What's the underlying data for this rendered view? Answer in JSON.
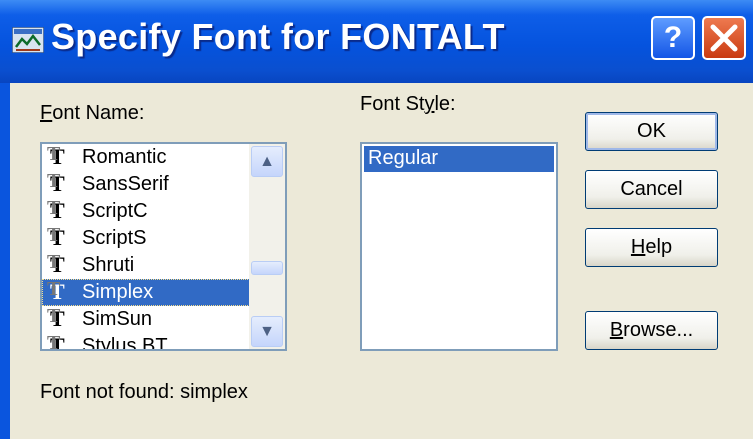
{
  "window": {
    "title": "Specify Font for FONTALT",
    "help_glyph": "?",
    "close_glyph": "✕"
  },
  "font_name": {
    "label": "Font Name:",
    "items": [
      {
        "label": "Romantic",
        "selected": false
      },
      {
        "label": "SansSerif",
        "selected": false
      },
      {
        "label": "ScriptC",
        "selected": false
      },
      {
        "label": "ScriptS",
        "selected": false
      },
      {
        "label": "Shruti",
        "selected": false
      },
      {
        "label": "Simplex",
        "selected": true
      },
      {
        "label": "SimSun",
        "selected": false
      },
      {
        "label": "Stylus BT",
        "selected": false
      }
    ],
    "icon": "truetype-font-icon",
    "scroll_up_glyph": "▲",
    "scroll_down_glyph": "▼"
  },
  "font_style": {
    "label": "Font Style:",
    "items": [
      "Regular"
    ]
  },
  "buttons": {
    "ok": "OK",
    "cancel": "Cancel",
    "help": "Help",
    "browse": "Browse..."
  },
  "status": "Font not found: simplex",
  "colors": {
    "titlebar": "#0553de",
    "selection": "#316ac5",
    "client": "#ece9d8"
  }
}
